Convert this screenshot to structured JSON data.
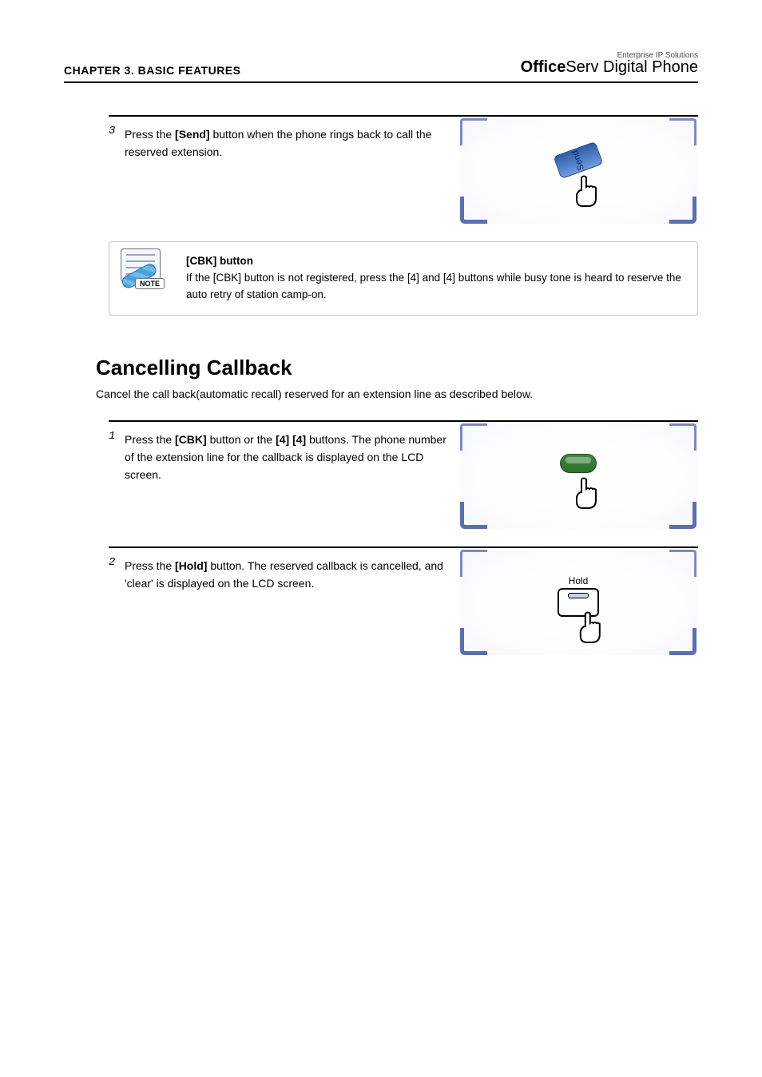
{
  "header": {
    "section_name": "CHAPTER 3. BASIC FEATURES",
    "brand_tagline": "Enterprise IP Solutions",
    "brand_product_bold": "Office",
    "brand_product_rest": "Serv Digital Phone"
  },
  "step_send": {
    "num": "3",
    "text_pre": "Press the ",
    "text_button": "[Send]",
    "text_post": " button when the phone rings back to call the reserved extension.",
    "illus_btn_label": "Send"
  },
  "note": {
    "icon_tag": "NOTE",
    "title": "[CBK] button",
    "body": "If the [CBK] button is not registered, press the [4] and [4] buttons while busy tone is heard to reserve the auto retry of station camp-on."
  },
  "heading": "Cancelling Callback",
  "para": "Cancel the call back(automatic recall) reserved for an extension line as described below.",
  "step_cbk": {
    "num": "1",
    "text_pre": "Press the ",
    "text_button1": "[CBK]",
    "text_mid": " button or the ",
    "text_button2": "[4] [4]",
    "text_post1": " buttons. The phone number of the extension line for the callback is displayed on the LCD screen."
  },
  "step_hold": {
    "num": "2",
    "text_pre": "Press the ",
    "text_button": "[Hold]",
    "text_post": " button. The reserved callback is cancelled, and 'clear' is displayed on the LCD screen.",
    "illus_label": "Hold"
  }
}
